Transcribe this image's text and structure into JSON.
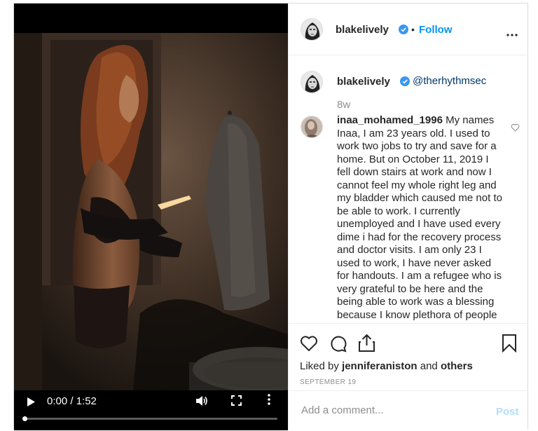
{
  "post_author": {
    "username": "blakelively",
    "follow_label": "Follow",
    "separator": "•"
  },
  "caption": {
    "username": "blakelively",
    "text": "@therhythmsec",
    "age": "8w"
  },
  "comments": [
    {
      "username": "inaa_mohamed_1996",
      "text": "My names Inaa, I am 23 years old. I used to work two jobs to try and save for a home. But on October 11, 2019 I fell down stairs at work and now I cannot feel my whole right leg and my bladder which caused me not to be able to work. I currently unemployed and I have used every dime i had for the recovery process and doctor visits. I am only 23 I used to work, I have never asked for handouts. I am a refugee who is very grateful to be here and the being able to work was a blessing because I know plethora of people who are not able to back"
    }
  ],
  "likes": {
    "prefix": "Liked by",
    "user": "jenniferaniston",
    "conjunction": "and",
    "others": "others"
  },
  "date": "SEPTEMBER 19",
  "add_comment": {
    "placeholder": "Add a comment...",
    "post_label": "Post"
  },
  "video": {
    "time_display": "0:00 / 1:52",
    "progress": 0.0
  },
  "icons": {
    "verified": "verified-badge-icon",
    "more": "more-options-icon",
    "like": "heart-icon",
    "comment": "comment-bubble-icon",
    "share": "share-icon",
    "save": "bookmark-icon",
    "play": "play-icon",
    "volume": "volume-icon",
    "fullscreen": "fullscreen-icon"
  },
  "colors": {
    "link": "#0095f6",
    "verified": "#3897f0",
    "text": "#262626",
    "muted": "#8e8e8e",
    "post_disabled": "#b2dffc"
  }
}
